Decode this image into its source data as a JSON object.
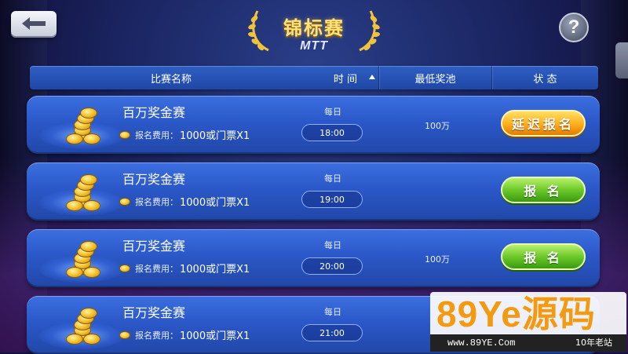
{
  "header": {
    "title": "锦标赛",
    "subtitle": "MTT",
    "help_label": "?"
  },
  "table_header": {
    "name": "比赛名称",
    "time": "时 间",
    "pool": "最低奖池",
    "status": "状 态"
  },
  "rows": [
    {
      "name": "百万奖金赛",
      "fee_label": "报名费用：",
      "fee": "1000或门票X1",
      "day": "每日",
      "time": "18:00",
      "pool": "100万",
      "button": "延迟报名",
      "button_style": "orange"
    },
    {
      "name": "百万奖金赛",
      "fee_label": "报名费用：",
      "fee": "1000或门票X1",
      "day": "每日",
      "time": "19:00",
      "pool": "",
      "button": "报 名",
      "button_style": "green"
    },
    {
      "name": "百万奖金赛",
      "fee_label": "报名费用：",
      "fee": "1000或门票X1",
      "day": "每日",
      "time": "20:00",
      "pool": "100万",
      "button": "报 名",
      "button_style": "green"
    },
    {
      "name": "百万奖金赛",
      "fee_label": "报名费用：",
      "fee": "1000或门票X1",
      "day": "每日",
      "time": "21:00",
      "pool": "",
      "button": "",
      "button_style": "green"
    }
  ],
  "watermark": {
    "logo": "89Ye源码",
    "url": "www.89YE.Com",
    "tag": "10年老站"
  },
  "colors": {
    "title_gold": "#ffe27a",
    "row_blue": "#2b58c8",
    "button_orange": "#ffb21f",
    "button_green": "#6cc92a"
  }
}
